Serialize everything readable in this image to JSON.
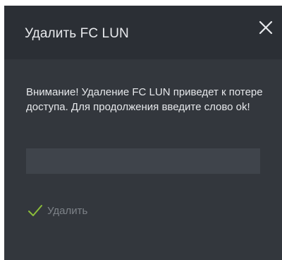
{
  "dialog": {
    "title": "Удалить FC LUN",
    "close_icon": "close-icon",
    "warning": "Внимание! Удаление FC LUN приведет к потере доступа. Для продолжения введите слово ok!",
    "input": {
      "value": "",
      "placeholder": ""
    },
    "delete_button": {
      "label": "Удалить",
      "icon": "check-icon",
      "icon_color": "#8bbd3a",
      "disabled": true
    }
  },
  "colors": {
    "dialog_bg": "#33373d",
    "header_bg": "#2b2f35",
    "input_bg": "#3f444b",
    "text": "#e6e8eb",
    "muted_text": "#7d8288"
  }
}
